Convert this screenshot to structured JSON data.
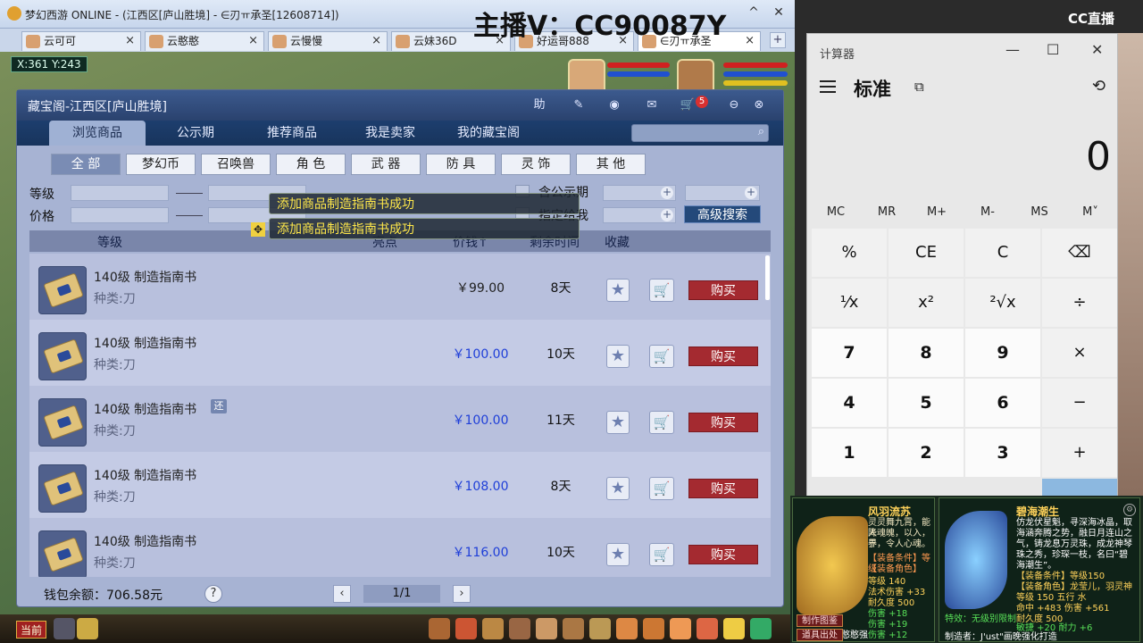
{
  "game": {
    "window_title": "梦幻西游 ONLINE - (江西区[庐山胜境] - ∈刃ㅠ承圣[12608714])",
    "minimize": "^",
    "close": "✕",
    "tabs": [
      {
        "label": "云可可"
      },
      {
        "label": "云憨憨"
      },
      {
        "label": "云慢慢"
      },
      {
        "label": "云妹36D"
      },
      {
        "label": "好运哥888"
      },
      {
        "label": "∈刃ㅠ承圣"
      }
    ],
    "tab_plus": "+",
    "coords": "X:361 Y:243",
    "current_tab": "当前"
  },
  "overlay": {
    "streamer_text": "主播V：CC90087Y",
    "platform": "CC直播"
  },
  "market": {
    "title": "藏宝阁-江西区[庐山胜境]",
    "header_help": "助",
    "cart_count": "5",
    "main_tabs": [
      "浏览商品",
      "公示期",
      "推荐商品",
      "我是卖家",
      "我的藏宝阁"
    ],
    "categories": [
      "全 部",
      "梦幻币",
      "召唤兽",
      "角 色",
      "武 器",
      "防 具",
      "灵 饰",
      "其 他"
    ],
    "filters": {
      "level_label": "等级",
      "price_label": "价格",
      "public_label": "含公示期",
      "assigned_label": "指定给我",
      "advanced_search": "高级搜索"
    },
    "toasts": [
      "添加商品制造指南书成功",
      "添加商品制造指南书成功"
    ],
    "columns": {
      "level": "等级",
      "highlight": "亮点",
      "price": "价钱↑",
      "time_left": "剩余时间",
      "favorite": "收藏"
    },
    "items": [
      {
        "name": "140级 制造指南书",
        "type": "种类:刀",
        "price": "￥99.00",
        "price_color": "#222222",
        "days": "8天",
        "badge": "",
        "buy": "购买"
      },
      {
        "name": "140级 制造指南书",
        "type": "种类:刀",
        "price": "￥100.00",
        "price_color": "#1f3fd8",
        "days": "10天",
        "badge": "",
        "buy": "购买"
      },
      {
        "name": "140级 制造指南书",
        "type": "种类:刀",
        "price": "￥100.00",
        "price_color": "#1f3fd8",
        "days": "11天",
        "badge": "还",
        "buy": "购买"
      },
      {
        "name": "140级 制造指南书",
        "type": "种类:刀",
        "price": "￥108.00",
        "price_color": "#1f3fd8",
        "days": "8天",
        "badge": "",
        "buy": "购买"
      },
      {
        "name": "140级 制造指南书",
        "type": "种类:刀",
        "price": "￥116.00",
        "price_color": "#1f3fd8",
        "days": "10天",
        "badge": "",
        "buy": "购买"
      }
    ],
    "wallet": "钱包余额：706.58元",
    "help": "?",
    "page": "1/1",
    "prev": "‹",
    "next": "›"
  },
  "calculator": {
    "title": "计算器",
    "mode": "标准",
    "display": "0",
    "memory": [
      "MC",
      "MR",
      "M+",
      "M-",
      "MS",
      "M˅"
    ],
    "keys": [
      [
        "%",
        "CE",
        "C",
        "⌫"
      ],
      [
        "¹⁄x",
        "x²",
        "²√x",
        "÷"
      ],
      [
        "7",
        "8",
        "9",
        "×"
      ],
      [
        "4",
        "5",
        "6",
        "−"
      ],
      [
        "1",
        "2",
        "3",
        "+"
      ]
    ]
  },
  "cards": [
    {
      "name": "风羽流苏",
      "lines": [
        "灵灵舞九霄，能降",
        "人魂魄，以入，于",
        "界，令人心魂。",
        "【装备条件】等级",
        "【装备角色】",
        "等级 140",
        "法术伤害 +33",
        "耐久度 500",
        "伤害 +18",
        "伤害 +19",
        "伤害 +12"
      ],
      "maker": "制造者：云憨憨强"
    },
    {
      "name": "碧海潮生",
      "lines": [
        "仿龙伏星魁，寻深海冰晶，取",
        "海涵奔腾之势，融日月连山之",
        "气，铸龙息万灵珠，成龙神琴",
        "珠之秀，珍琛一枝，名曰“碧",
        "海潮生”。",
        "【装备条件】等级150",
        "【装备角色】龙莹儿，羽灵神",
        "等级 150  五行 水",
        "命中 +483  伤害 +561",
        "耐久度 500",
        "敏捷 +20  耐力 +6",
        "特效：无级别限制"
      ],
      "maker": "制造者：J'ust\"画晚强化打造"
    }
  ],
  "card_buttons": [
    "制作图鉴",
    "道具出处"
  ]
}
